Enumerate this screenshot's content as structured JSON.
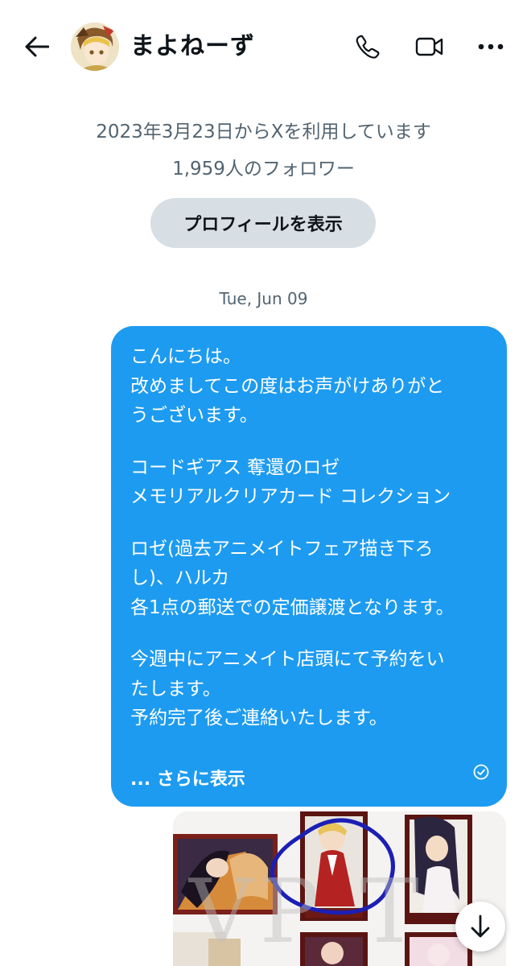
{
  "header": {
    "title": "まよねーず",
    "back_icon": "arrow-left-icon",
    "call_icon": "phone-icon",
    "video_icon": "video-camera-icon",
    "more_icon": "ellipsis-icon"
  },
  "profile": {
    "joined": "2023年3月23日からXを利用しています",
    "followers": "1,959人のフォロワー",
    "view_profile_label": "プロフィールを表示"
  },
  "conversation": {
    "date_separator": "Tue, Jun 09",
    "message": {
      "lines": [
        "こんにちは。",
        "改めましてこの度はお声がけありがと",
        "うございます。",
        "",
        "コードギアス 奪還のロゼ",
        "メモリアルクリアカード コレクション",
        "",
        "ロゼ(過去アニメイトフェア描き下ろ",
        "し)、ハルカ",
        "各1点の郵送での定価譲渡となります。",
        "",
        "今週中にアニメイト店頭にて予約をい",
        "たします。",
        "予約完了後ご連絡いたします。"
      ],
      "show_more_label": "... さらに表示",
      "status_icon": "sent-check-icon",
      "bubble_color": "#1d9bf0"
    },
    "attachment": {
      "type": "image",
      "description_icon": "card-photo-icon",
      "watermark": "VP T"
    },
    "scroll_down_icon": "arrow-down-icon"
  }
}
